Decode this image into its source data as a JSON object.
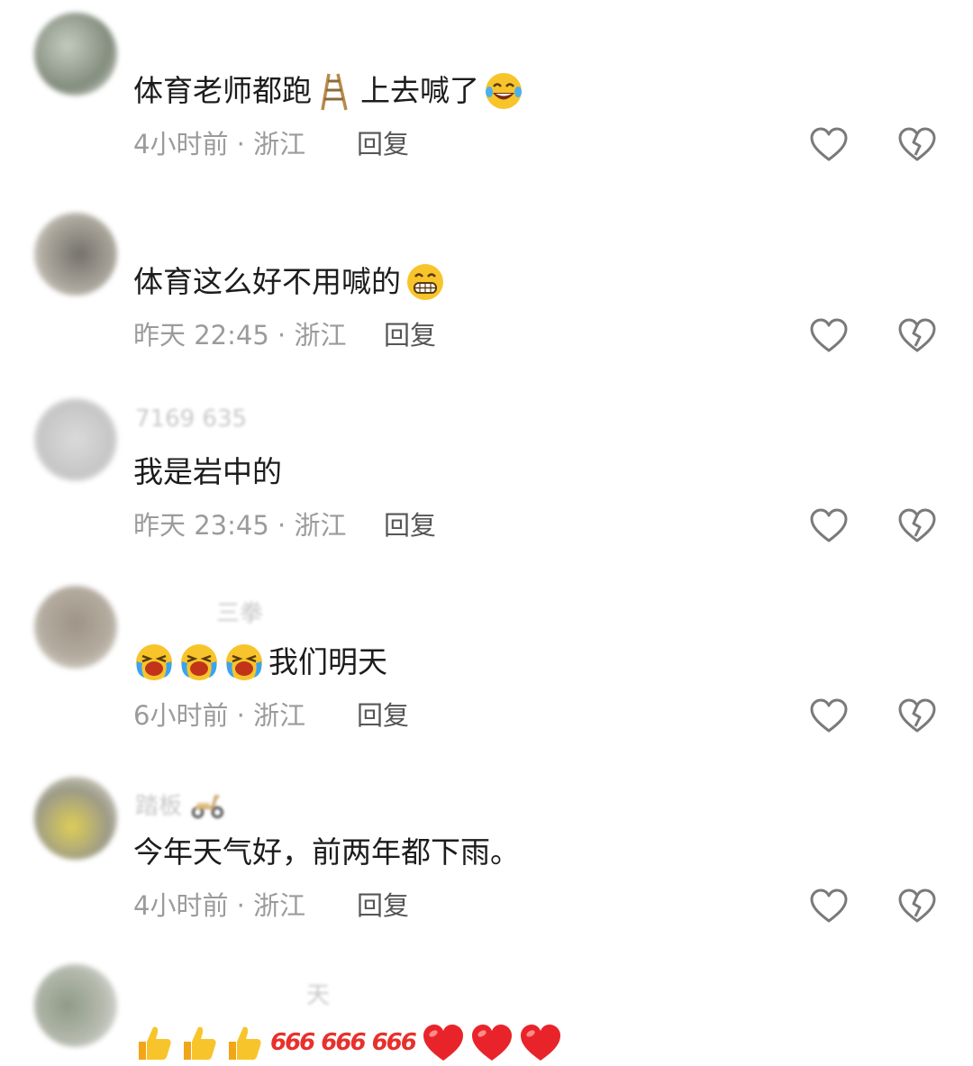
{
  "comments": [
    {
      "username": "",
      "text": "体育老师都跑",
      "text_after": "上去喊了",
      "emojis": [
        "ladder-emoji",
        "tears-of-joy-emoji"
      ],
      "time_location": "4小时前 · 浙江",
      "reply_label": "回复"
    },
    {
      "username": "",
      "text": "体育这么好不用喊的",
      "emojis": [
        "grinning-emoji"
      ],
      "time_location": "昨天 22:45 · 浙江",
      "reply_label": "回复"
    },
    {
      "username": "7169  635",
      "text": "我是岩中的",
      "time_location": "昨天 23:45 · 浙江",
      "reply_label": "回复"
    },
    {
      "username": "三拳",
      "text": "我们明天",
      "emojis": [
        "crying-laugh-emoji",
        "crying-laugh-emoji",
        "crying-laugh-emoji"
      ],
      "time_location": "6小时前 · 浙江",
      "reply_label": "回复"
    },
    {
      "username": "踏板",
      "text": "今年天气好，前两年都下雨。",
      "emojis": [
        "scooter-emoji"
      ],
      "time_location": "4小时前 · 浙江",
      "reply_label": "回复"
    },
    {
      "username": "天",
      "text_parts": [
        "666",
        "666",
        "666"
      ],
      "emojis": [
        "thumbs-up-emoji",
        "thumbs-up-emoji",
        "thumbs-up-emoji",
        "heart-emoji",
        "heart-emoji",
        "heart-emoji"
      ]
    }
  ],
  "icons": {
    "like": "heart-outline-icon",
    "dislike": "broken-heart-icon"
  },
  "colors": {
    "text": "#1c1c1c",
    "meta": "#9b9b9b",
    "reply": "#555555",
    "icon": "#7a7a7a",
    "accent": "#e8302c"
  }
}
